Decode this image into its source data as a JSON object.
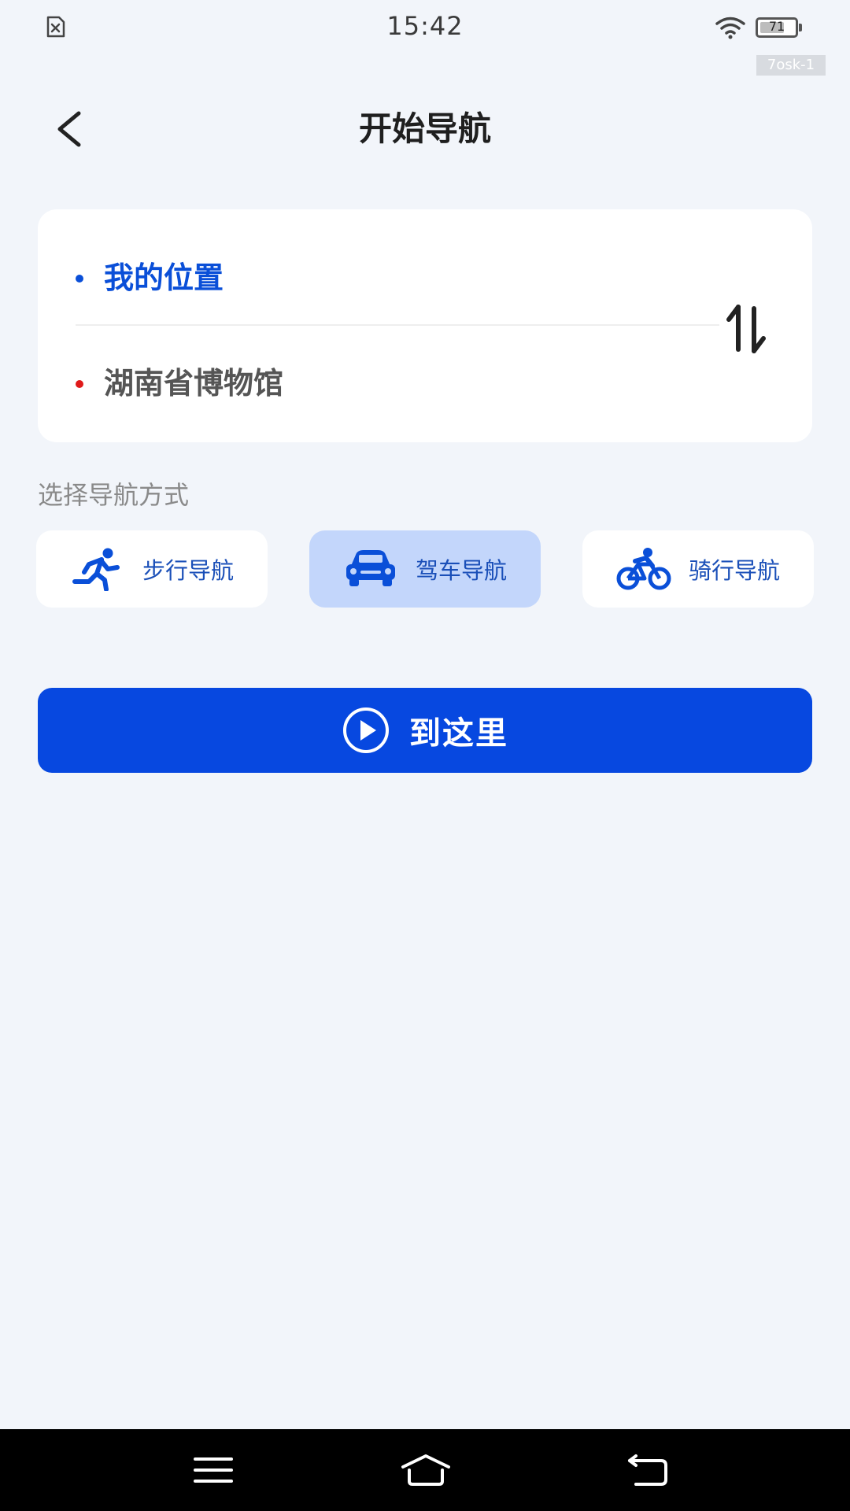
{
  "status_bar": {
    "time": "15:42",
    "battery_level": "71",
    "battery_fraction": 0.71,
    "left_icon": "sim-error-icon",
    "wifi_icon": "wifi-icon",
    "debug_label": "7osk-1"
  },
  "header": {
    "back_icon": "back-arrow-icon",
    "title": "开始导航"
  },
  "route": {
    "start": {
      "label": "我的位置",
      "dot_color": "#0a4fd8"
    },
    "end": {
      "label": "湖南省博物馆",
      "dot_color": "#e01a1a"
    },
    "swap_icon": "swap-vertical-icon"
  },
  "mode_section": {
    "label": "选择导航方式",
    "modes": [
      {
        "label": "步行导航",
        "icon": "walking-icon",
        "selected": false
      },
      {
        "label": "驾车导航",
        "icon": "car-icon",
        "selected": true
      },
      {
        "label": "骑行导航",
        "icon": "bicycle-icon",
        "selected": false
      }
    ]
  },
  "action": {
    "label": "到这里",
    "icon": "play-circle-icon",
    "color": "#0748e0"
  },
  "nav_bar": {
    "icons": [
      "menu-icon",
      "home-icon",
      "back-icon"
    ]
  }
}
